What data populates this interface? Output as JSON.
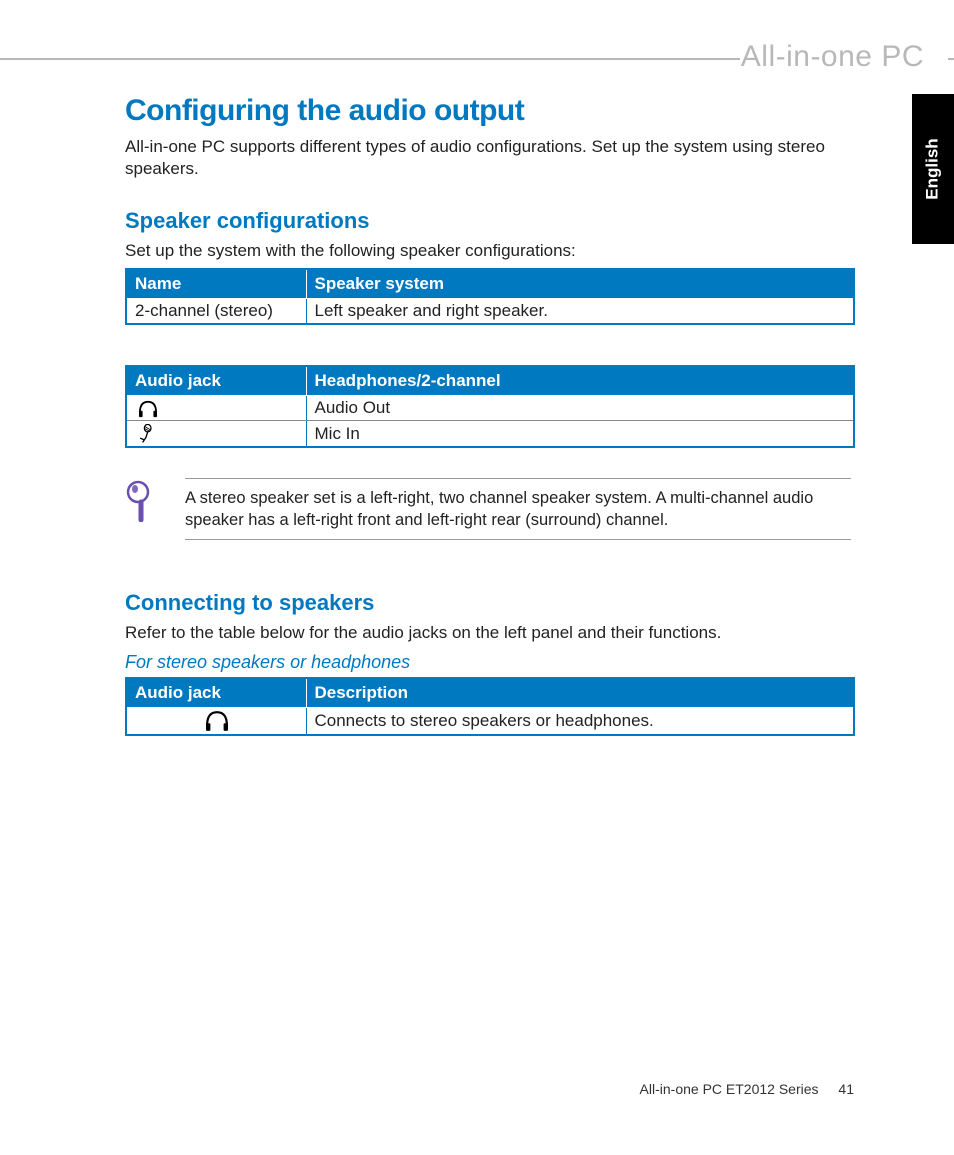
{
  "brand": "All-in-one PC",
  "language_tab": "English",
  "h1": "Configuring the audio output",
  "intro": "All-in-one PC supports different types of audio configurations. Set up the system using stereo speakers.",
  "section1": {
    "heading": "Speaker configurations",
    "lead": "Set up the system with the following speaker configurations:",
    "table1": {
      "headers": [
        "Name",
        "Speaker system"
      ],
      "rows": [
        [
          "2-channel (stereo)",
          "Left speaker and right speaker."
        ]
      ]
    },
    "table2": {
      "headers": [
        "Audio jack",
        "Headphones/2-channel"
      ],
      "rows": [
        {
          "icon": "headphone-icon",
          "text": "Audio Out"
        },
        {
          "icon": "mic-icon",
          "text": "Mic In"
        }
      ]
    }
  },
  "note": "A stereo speaker set is a left-right, two channel speaker system. A multi-channel audio speaker has a left-right front and left-right rear (surround) channel.",
  "section2": {
    "heading": "Connecting to speakers",
    "lead": "Refer to the table below for the audio jacks on the left panel and their functions.",
    "subhead": "For stereo speakers or headphones",
    "table": {
      "headers": [
        "Audio jack",
        "Description"
      ],
      "rows": [
        {
          "icon": "headphone-icon",
          "text": "Connects to stereo speakers or headphones."
        }
      ]
    }
  },
  "footer": {
    "series": "All-in-one PC ET2012 Series",
    "page": "41"
  }
}
